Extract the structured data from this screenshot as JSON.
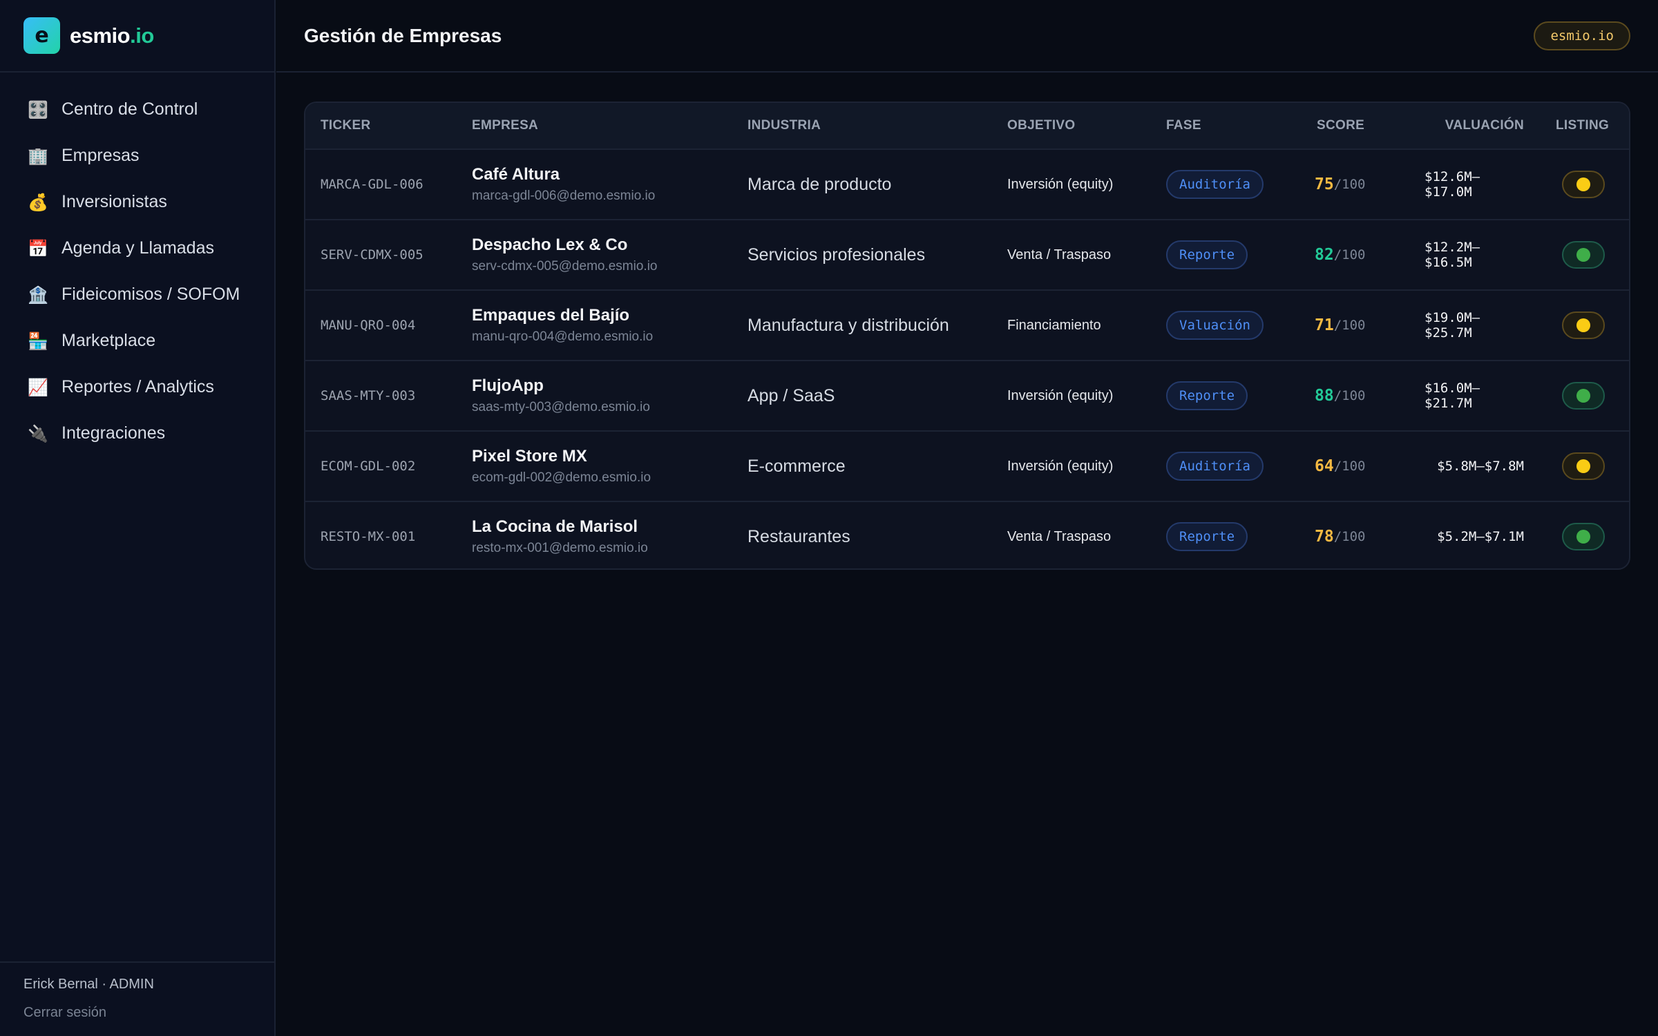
{
  "brand": {
    "mark": "e",
    "name": "esmio",
    "tld": ".io"
  },
  "sidebar": {
    "items": [
      {
        "icon": "🎛️",
        "icon_name": "control-knobs-icon",
        "label": "Centro de Control"
      },
      {
        "icon": "🏢",
        "icon_name": "office-building-icon",
        "label": "Empresas"
      },
      {
        "icon": "💰",
        "icon_name": "money-bag-icon",
        "label": "Inversionistas"
      },
      {
        "icon": "📅",
        "icon_name": "calendar-icon",
        "label": "Agenda y Llamadas"
      },
      {
        "icon": "🏦",
        "icon_name": "bank-icon",
        "label": "Fideicomisos / SOFOM"
      },
      {
        "icon": "🏪",
        "icon_name": "store-icon",
        "label": "Marketplace"
      },
      {
        "icon": "📈",
        "icon_name": "chart-increasing-icon",
        "label": "Reportes / Analytics"
      },
      {
        "icon": "🔌",
        "icon_name": "plug-icon",
        "label": "Integraciones"
      }
    ],
    "user": "Erick Bernal · ADMIN",
    "logout": "Cerrar sesión"
  },
  "header": {
    "title": "Gestión de Empresas",
    "domain_badge": "esmio.io"
  },
  "table": {
    "columns": {
      "ticker": "TICKER",
      "empresa": "EMPRESA",
      "industria": "INDUSTRIA",
      "objetivo": "OBJETIVO",
      "fase": "FASE",
      "score": "SCORE",
      "valuacion": "VALUACIÓN",
      "listing": "LISTING"
    },
    "rows": [
      {
        "ticker": "MARCA-GDL-006",
        "name": "Café Altura",
        "email": "marca-gdl-006@demo.esmio.io",
        "industry": "Marca de producto",
        "objective": "Inversión (equity)",
        "phase": "Auditoría",
        "score": "75",
        "score_max": "/100",
        "score_color": "#f5b942",
        "valuation": "$12.6M–$17.0M",
        "listing": "yellow"
      },
      {
        "ticker": "SERV-CDMX-005",
        "name": "Despacho Lex & Co",
        "email": "serv-cdmx-005@demo.esmio.io",
        "industry": "Servicios profesionales",
        "objective": "Venta / Traspaso",
        "phase": "Reporte",
        "score": "82",
        "score_max": "/100",
        "score_color": "#22c997",
        "valuation": "$12.2M–$16.5M",
        "listing": "green"
      },
      {
        "ticker": "MANU-QRO-004",
        "name": "Empaques del Bajío",
        "email": "manu-qro-004@demo.esmio.io",
        "industry": "Manufactura y distribución",
        "objective": "Financiamiento",
        "phase": "Valuación",
        "score": "71",
        "score_max": "/100",
        "score_color": "#f5b942",
        "valuation": "$19.0M–$25.7M",
        "listing": "yellow"
      },
      {
        "ticker": "SAAS-MTY-003",
        "name": "FlujoApp",
        "email": "saas-mty-003@demo.esmio.io",
        "industry": "App / SaaS",
        "objective": "Inversión (equity)",
        "phase": "Reporte",
        "score": "88",
        "score_max": "/100",
        "score_color": "#22c997",
        "valuation": "$16.0M–$21.7M",
        "listing": "green"
      },
      {
        "ticker": "ECOM-GDL-002",
        "name": "Pixel Store MX",
        "email": "ecom-gdl-002@demo.esmio.io",
        "industry": "E-commerce",
        "objective": "Inversión (equity)",
        "phase": "Auditoría",
        "score": "64",
        "score_max": "/100",
        "score_color": "#f5b942",
        "valuation": "$5.8M–$7.8M",
        "listing": "yellow"
      },
      {
        "ticker": "RESTO-MX-001",
        "name": "La Cocina de Marisol",
        "email": "resto-mx-001@demo.esmio.io",
        "industry": "Restaurantes",
        "objective": "Venta / Traspaso",
        "phase": "Reporte",
        "score": "78",
        "score_max": "/100",
        "score_color": "#f5b942",
        "valuation": "$5.2M–$7.1M",
        "listing": "green"
      }
    ]
  },
  "colors": {
    "listing_yellow": {
      "dot": "#facc15",
      "border": "#5b4a1e",
      "bg": "#1f1c12"
    },
    "listing_green": {
      "dot": "#3fae49",
      "border": "#1e5b4a",
      "bg": "#0f2a25"
    }
  }
}
